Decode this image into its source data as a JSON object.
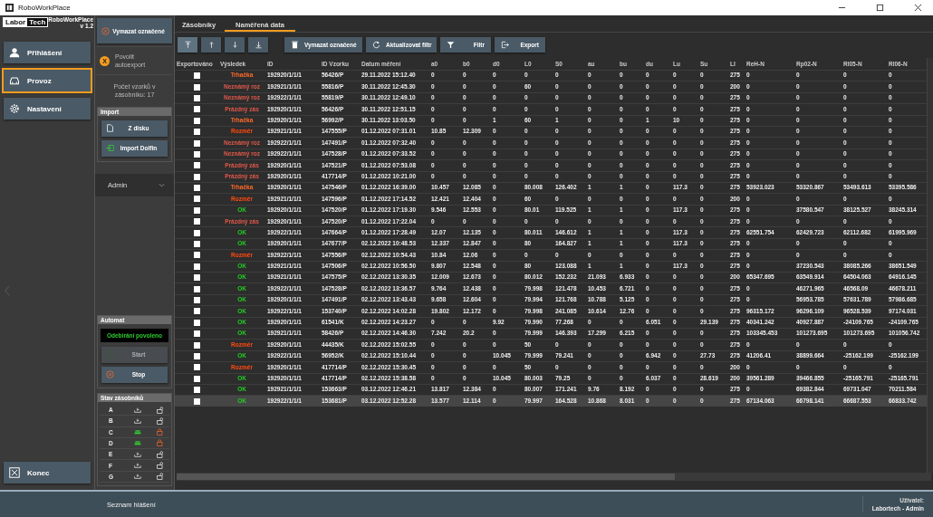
{
  "window": {
    "title": "RoboWorkPlace"
  },
  "logo": {
    "part1": "Labor",
    "part2": "Tech"
  },
  "app": {
    "name": "RoboWorkPlace",
    "version": "v 1.2"
  },
  "nav": [
    {
      "label": "Přihlášení",
      "kind": "user",
      "selected": false
    },
    {
      "label": "Provoz",
      "kind": "car",
      "selected": true
    },
    {
      "label": "Nastavení",
      "kind": "gear",
      "selected": false
    }
  ],
  "exit_button": "Konec",
  "panel": {
    "clear_button": "Vymazat označené",
    "autoexport": {
      "label": "Povolit autoexport",
      "badge": "X"
    },
    "count_label": "Počet vzorků v zásobníku:",
    "count": "17",
    "import": {
      "title": "Import",
      "buttons": [
        {
          "label": "Z disku",
          "kind": "file"
        },
        {
          "label": "Import Dolfin",
          "kind": "import"
        }
      ]
    },
    "user_select": "Admin",
    "automat": {
      "title": "Automat",
      "status": "Odebírání povoleno",
      "buttons": [
        {
          "label": "Start",
          "kind": "start",
          "disabled": true
        },
        {
          "label": "Stop",
          "kind": "stop",
          "disabled": false
        }
      ]
    },
    "magazines": {
      "title": "Stav zásobníků",
      "items": [
        {
          "label": "A",
          "loaded": false,
          "locked": false
        },
        {
          "label": "B",
          "loaded": false,
          "locked": false
        },
        {
          "label": "C",
          "loaded": true,
          "locked": true
        },
        {
          "label": "D",
          "loaded": true,
          "locked": true
        },
        {
          "label": "E",
          "loaded": false,
          "locked": false
        },
        {
          "label": "F",
          "loaded": false,
          "locked": false
        },
        {
          "label": "G",
          "loaded": false,
          "locked": false
        }
      ]
    }
  },
  "tabs": [
    {
      "label": "Zásobníky",
      "selected": false
    },
    {
      "label": "Naměřená data",
      "selected": true
    }
  ],
  "toolbar": {
    "move_buttons": [
      {
        "kind": "top"
      },
      {
        "kind": "up"
      },
      {
        "kind": "down"
      },
      {
        "kind": "bottom"
      }
    ],
    "buttons": [
      {
        "label": "Vymazat označené",
        "kind": "trash"
      },
      {
        "label": "Aktualizovat filtr",
        "kind": "refresh"
      },
      {
        "label": "Filtr",
        "kind": "filter"
      },
      {
        "label": "Export",
        "kind": "export"
      }
    ]
  },
  "table": {
    "export_column": "Exportováno",
    "result_column": "Výsledek",
    "columns": [
      "ID",
      "ID Vzorku",
      "Datum měření",
      "a0",
      "b0",
      "d0",
      "L0",
      "S0",
      "au",
      "bu",
      "du",
      "Lu",
      "Su",
      "LI",
      "ReH-N",
      "Rp02-N",
      "Rl05-N",
      "Rl06-N"
    ],
    "rows": [
      {
        "exported": false,
        "selected": false,
        "result": "Trhačka",
        "color": "#ff6a2a",
        "cells": [
          "192920/1/1/1",
          "56426/P",
          "29.11.2022 15:12.40",
          "0",
          "0",
          "0",
          "0",
          "0",
          "0",
          "0",
          "0",
          "0",
          "0",
          "275",
          "0",
          "0",
          "0",
          "0"
        ]
      },
      {
        "exported": false,
        "selected": false,
        "result": "Neznámý roz",
        "color": "#e0584a",
        "cells": [
          "192921/1/1/1",
          "55816/P",
          "30.11.2022 12:45.30",
          "0",
          "0",
          "0",
          "60",
          "0",
          "0",
          "0",
          "0",
          "0",
          "0",
          "200",
          "0",
          "0",
          "0",
          "0"
        ]
      },
      {
        "exported": false,
        "selected": false,
        "result": "Neznámý roz",
        "color": "#e0584a",
        "cells": [
          "192922/1/1/1",
          "55819/P",
          "30.11.2022 12:49.10",
          "0",
          "0",
          "0",
          "0",
          "0",
          "0",
          "0",
          "0",
          "0",
          "0",
          "275",
          "0",
          "0",
          "0",
          "0"
        ]
      },
      {
        "exported": false,
        "selected": false,
        "result": "Prázdný zás",
        "color": "#e0584a",
        "cells": [
          "192920/1/1/1",
          "56426/P",
          "30.11.2022 12:51.15",
          "0",
          "0",
          "0",
          "0",
          "0",
          "0",
          "0",
          "0",
          "0",
          "0",
          "275",
          "0",
          "0",
          "0",
          "0"
        ]
      },
      {
        "exported": false,
        "selected": false,
        "result": "Trhačka",
        "color": "#ff6a2a",
        "cells": [
          "192920/1/1/1",
          "56992/P",
          "30.11.2022 13:03.50",
          "0",
          "0",
          "1",
          "60",
          "1",
          "0",
          "0",
          "1",
          "10",
          "0",
          "275",
          "0",
          "0",
          "0",
          "0"
        ]
      },
      {
        "exported": false,
        "selected": false,
        "result": "Rozměr",
        "color": "#ff4a10",
        "cells": [
          "192921/1/1/1",
          "147555/P",
          "01.12.2022 07:31.01",
          "10.85",
          "12.309",
          "0",
          "0",
          "0",
          "0",
          "0",
          "0",
          "0",
          "0",
          "275",
          "0",
          "0",
          "0",
          "0"
        ]
      },
      {
        "exported": false,
        "selected": false,
        "result": "Neznámý roz",
        "color": "#e0584a",
        "cells": [
          "192922/1/1/1",
          "147491/P",
          "01.12.2022 07:32.40",
          "0",
          "0",
          "0",
          "0",
          "0",
          "0",
          "0",
          "0",
          "0",
          "0",
          "275",
          "0",
          "0",
          "0",
          "0"
        ]
      },
      {
        "exported": false,
        "selected": false,
        "result": "Neznámý roz",
        "color": "#e0584a",
        "cells": [
          "192922/1/1/1",
          "147528/P",
          "01.12.2022 07:33.52",
          "0",
          "0",
          "0",
          "0",
          "0",
          "0",
          "0",
          "0",
          "0",
          "0",
          "275",
          "0",
          "0",
          "0",
          "0"
        ]
      },
      {
        "exported": false,
        "selected": false,
        "result": "Prázdný zás",
        "color": "#e0584a",
        "cells": [
          "192920/1/1/1",
          "147521/P",
          "01.12.2022 07:53.08",
          "0",
          "0",
          "0",
          "0",
          "0",
          "0",
          "0",
          "0",
          "0",
          "0",
          "275",
          "0",
          "0",
          "0",
          "0"
        ]
      },
      {
        "exported": false,
        "selected": false,
        "result": "Prázdný zás",
        "color": "#e0584a",
        "cells": [
          "192920/1/1/1",
          "417714/P",
          "01.12.2022 10:21.00",
          "0",
          "0",
          "0",
          "0",
          "0",
          "0",
          "0",
          "0",
          "0",
          "0",
          "275",
          "0",
          "0",
          "0",
          "0"
        ]
      },
      {
        "exported": false,
        "selected": false,
        "result": "Trhačka",
        "color": "#ff6a2a",
        "cells": [
          "192920/1/1/1",
          "147546/P",
          "01.12.2022 16:39.00",
          "10.457",
          "12.085",
          "0",
          "80.008",
          "126.402",
          "1",
          "1",
          "0",
          "117.3",
          "0",
          "275",
          "53923.023",
          "53320.867",
          "53493.613",
          "53395.586"
        ]
      },
      {
        "exported": false,
        "selected": false,
        "result": "Rozměr",
        "color": "#ff4a10",
        "cells": [
          "192921/1/1/1",
          "147596/P",
          "01.12.2022 17:14.52",
          "12.421",
          "12.404",
          "0",
          "60",
          "0",
          "0",
          "0",
          "0",
          "0",
          "0",
          "200",
          "0",
          "0",
          "0",
          "0"
        ]
      },
      {
        "exported": false,
        "selected": false,
        "result": "OK",
        "color": "#22cc22",
        "cells": [
          "192920/1/1/1",
          "147520/P",
          "01.12.2022 17:19.30",
          "9.546",
          "12.553",
          "0",
          "80.01",
          "119.525",
          "1",
          "1",
          "0",
          "117.3",
          "0",
          "275",
          "0",
          "37580.547",
          "38125.527",
          "38245.314"
        ]
      },
      {
        "exported": false,
        "selected": false,
        "result": "Prázdný zás",
        "color": "#e0584a",
        "cells": [
          "192920/1/1/1",
          "147520/P",
          "01.12.2022 17:22.04",
          "0",
          "0",
          "0",
          "0",
          "0",
          "0",
          "0",
          "0",
          "0",
          "0",
          "275",
          "0",
          "0",
          "0",
          "0"
        ]
      },
      {
        "exported": false,
        "selected": false,
        "result": "OK",
        "color": "#22cc22",
        "cells": [
          "192922/1/1/1",
          "147664/P",
          "01.12.2022 17:28.49",
          "12.07",
          "12.135",
          "0",
          "80.011",
          "146.612",
          "1",
          "1",
          "0",
          "117.3",
          "0",
          "275",
          "62551.754",
          "62429.723",
          "62112.682",
          "61995.969"
        ]
      },
      {
        "exported": false,
        "selected": false,
        "result": "OK",
        "color": "#22cc22",
        "cells": [
          "192920/1/1/1",
          "147677/P",
          "02.12.2022 10:48.53",
          "12.337",
          "12.847",
          "0",
          "80",
          "164.827",
          "1",
          "1",
          "0",
          "117.3",
          "0",
          "275",
          "0",
          "0",
          "0",
          "0"
        ]
      },
      {
        "exported": false,
        "selected": false,
        "result": "Rozměr",
        "color": "#ff4a10",
        "cells": [
          "192922/1/1/1",
          "147556/P",
          "02.12.2022 10:54.43",
          "10.84",
          "12.06",
          "0",
          "0",
          "0",
          "0",
          "0",
          "0",
          "0",
          "0",
          "275",
          "0",
          "0",
          "0",
          "0"
        ]
      },
      {
        "exported": false,
        "selected": false,
        "result": "OK",
        "color": "#22cc22",
        "cells": [
          "192921/1/1/1",
          "147506/P",
          "02.12.2022 10:56.50",
          "9.807",
          "12.548",
          "0",
          "80",
          "123.088",
          "1",
          "1",
          "0",
          "117.3",
          "0",
          "275",
          "0",
          "37230.543",
          "38085.266",
          "38651.549"
        ]
      },
      {
        "exported": false,
        "selected": false,
        "result": "OK",
        "color": "#22cc22",
        "cells": [
          "192921/1/1/1",
          "147575/P",
          "02.12.2022 13:30.35",
          "12.009",
          "12.673",
          "0",
          "80.012",
          "152.232",
          "21.093",
          "6.933",
          "0",
          "0",
          "0",
          "200",
          "65347.695",
          "63549.914",
          "64504.063",
          "64916.145"
        ]
      },
      {
        "exported": false,
        "selected": false,
        "result": "OK",
        "color": "#22cc22",
        "cells": [
          "192922/1/1/1",
          "147528/P",
          "02.12.2022 13:36.57",
          "9.764",
          "12.438",
          "0",
          "79.998",
          "121.478",
          "10.453",
          "6.721",
          "0",
          "0",
          "0",
          "275",
          "0",
          "46271.965",
          "46568.09",
          "46678.211"
        ]
      },
      {
        "exported": false,
        "selected": false,
        "result": "OK",
        "color": "#22cc22",
        "cells": [
          "192920/1/1/1",
          "147491/P",
          "02.12.2022 13:43.43",
          "9.658",
          "12.604",
          "0",
          "79.994",
          "121.768",
          "10.788",
          "5.125",
          "0",
          "0",
          "0",
          "275",
          "0",
          "56953.785",
          "57631.789",
          "57986.685"
        ]
      },
      {
        "exported": false,
        "selected": false,
        "result": "OK",
        "color": "#22cc22",
        "cells": [
          "192922/1/1/1",
          "153740/P",
          "02.12.2022 14:02.28",
          "19.802",
          "12.172",
          "0",
          "79.998",
          "241.085",
          "10.614",
          "12.76",
          "0",
          "0",
          "0",
          "275",
          "96315.172",
          "96296.109",
          "96528.539",
          "97174.031"
        ]
      },
      {
        "exported": false,
        "selected": false,
        "result": "OK",
        "color": "#22cc22",
        "cells": [
          "192920/1/1/1",
          "61541/K",
          "02.12.2022 14:23.27",
          "0",
          "0",
          "9.92",
          "79.990",
          "77.268",
          "0",
          "0",
          "6.051",
          "0",
          "29.139",
          "275",
          "40341.242",
          "40927.887",
          "-24109.765",
          "-24109.765"
        ]
      },
      {
        "exported": false,
        "selected": false,
        "result": "OK",
        "color": "#22cc22",
        "cells": [
          "192921/1/1/1",
          "58426/P",
          "02.12.2022 14:46.30",
          "7.242",
          "20.2",
          "0",
          "79.999",
          "146.393",
          "17.299",
          "6.215",
          "0",
          "0",
          "0",
          "275",
          "103345.453",
          "101273.695",
          "101273.695",
          "101056.742"
        ]
      },
      {
        "exported": false,
        "selected": false,
        "result": "Rozměr",
        "color": "#ff4a10",
        "cells": [
          "192920/1/1/1",
          "44435/K",
          "02.12.2022 15:02.55",
          "0",
          "0",
          "0",
          "50",
          "0",
          "0",
          "0",
          "0",
          "0",
          "0",
          "275",
          "0",
          "0",
          "0",
          "0"
        ]
      },
      {
        "exported": false,
        "selected": false,
        "result": "OK",
        "color": "#22cc22",
        "cells": [
          "192922/1/1/1",
          "56952/K",
          "02.12.2022 15:10.44",
          "0",
          "0",
          "10.045",
          "79.999",
          "79.241",
          "0",
          "0",
          "6.942",
          "0",
          "27.73",
          "275",
          "41206.41",
          "38899.664",
          "-25162.199",
          "-25162.199"
        ]
      },
      {
        "exported": false,
        "selected": false,
        "result": "Rozměr",
        "color": "#ff4a10",
        "cells": [
          "192920/1/1/1",
          "417714/P",
          "02.12.2022 15:30.45",
          "0",
          "0",
          "0",
          "50",
          "0",
          "0",
          "0",
          "0",
          "0",
          "0",
          "200",
          "0",
          "0",
          "0",
          "0"
        ]
      },
      {
        "exported": false,
        "selected": false,
        "result": "OK",
        "color": "#22cc22",
        "cells": [
          "192920/1/1/1",
          "417714/P",
          "02.12.2022 15:38.58",
          "0",
          "0",
          "10.045",
          "80.003",
          "79.25",
          "0",
          "0",
          "6.037",
          "0",
          "28.619",
          "200",
          "39561.289",
          "39466.855",
          "-25165.791",
          "-25165.791"
        ]
      },
      {
        "exported": false,
        "selected": false,
        "result": "OK",
        "color": "#22cc22",
        "cells": [
          "192921/1/1/1",
          "153663/P",
          "03.12.2022 12:46.21",
          "13.817",
          "12.384",
          "0",
          "80.007",
          "171.241",
          "9.76",
          "8.192",
          "0",
          "0",
          "0",
          "275",
          "0",
          "69382.844",
          "69731.047",
          "70211.584"
        ]
      },
      {
        "exported": false,
        "selected": true,
        "result": "OK",
        "color": "#22cc22",
        "cells": [
          "192922/1/1/1",
          "153681/P",
          "03.12.2022 12:52.28",
          "13.577",
          "12.114",
          "0",
          "79.997",
          "164.528",
          "10.868",
          "8.031",
          "0",
          "0",
          "0",
          "275",
          "67134.063",
          "66798.141",
          "66687.553",
          "66833.742"
        ]
      }
    ]
  },
  "status_bar": {
    "messages_tab": "Seznam hlášení",
    "user_label": "Uživatel:",
    "user": "Labortech - Admin"
  }
}
